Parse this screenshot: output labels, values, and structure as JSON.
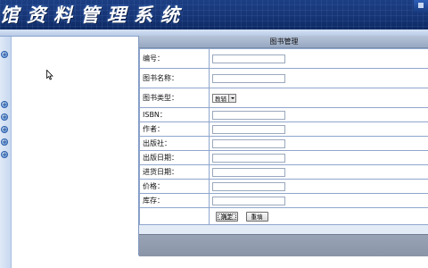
{
  "header": {
    "title": "馆资料管理系统"
  },
  "sidebar": {
    "buttons": [
      {
        "icon": "expand-plus-icon",
        "glyph": "+"
      },
      {
        "icon": "expand-plus-icon",
        "glyph": "+"
      },
      {
        "icon": "expand-plus-icon",
        "glyph": "+"
      },
      {
        "icon": "expand-plus-icon",
        "glyph": "+"
      },
      {
        "icon": "expand-plus-icon",
        "glyph": "+"
      },
      {
        "icon": "expand-plus-icon",
        "glyph": "+"
      }
    ]
  },
  "panel": {
    "title": "图书管理",
    "fields": {
      "id": {
        "label": "编号：",
        "value": ""
      },
      "name": {
        "label": "图书名称：",
        "value": ""
      },
      "type": {
        "label": "图书类型：",
        "selected": "教辅"
      },
      "isbn": {
        "label": "ISBN：",
        "value": ""
      },
      "author": {
        "label": "作者：",
        "value": ""
      },
      "publisher": {
        "label": "出版社：",
        "value": ""
      },
      "pub_date": {
        "label": "出版日期：",
        "value": ""
      },
      "stock_date": {
        "label": "进货日期：",
        "value": ""
      },
      "price": {
        "label": "价格：",
        "value": ""
      },
      "inventory": {
        "label": "库存：",
        "value": ""
      }
    },
    "buttons": {
      "confirm": "确定",
      "reset": "重填"
    }
  },
  "colors": {
    "banner": "#163576",
    "panel_header": "#b6c3d8",
    "panel_background": "#e3ebf6",
    "border": "#8fa6cd"
  }
}
